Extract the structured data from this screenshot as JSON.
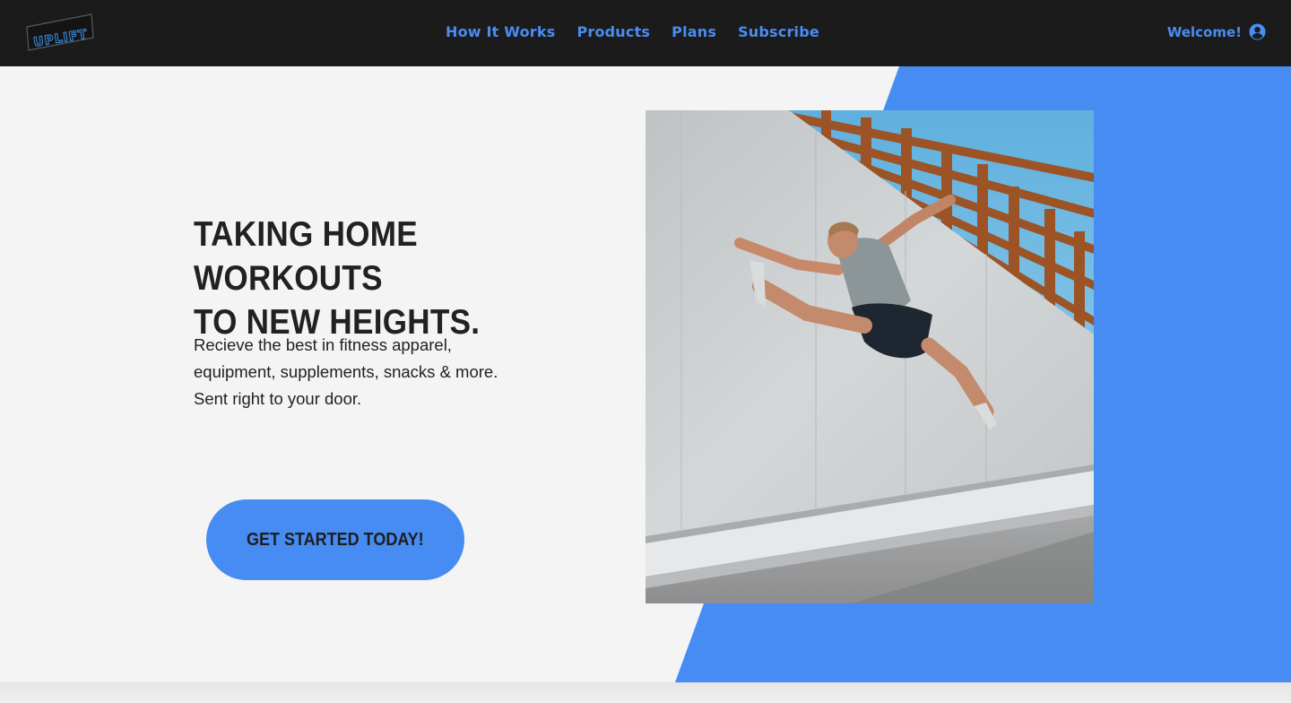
{
  "header": {
    "logo_text": "UPLIFT",
    "nav": [
      {
        "label": "How It Works"
      },
      {
        "label": "Products"
      },
      {
        "label": "Plans"
      },
      {
        "label": "Subscribe"
      }
    ],
    "welcome_label": "Welcome!",
    "user_icon": "user-circle-icon"
  },
  "hero": {
    "headline_line1": "TAKING HOME WORKOUTS",
    "headline_line2": "TO NEW HEIGHTS.",
    "subtext_line1": "Recieve the best in fitness apparel,",
    "subtext_line2": "equipment, supplements, snacks & more.",
    "subtext_line3": "Sent right to your door.",
    "cta_label": "GET STARTED TODAY!"
  },
  "colors": {
    "header_bg": "#1b1b1b",
    "accent_blue": "#468cf3",
    "page_bg": "#f4f4f4",
    "text_dark": "#212121"
  }
}
